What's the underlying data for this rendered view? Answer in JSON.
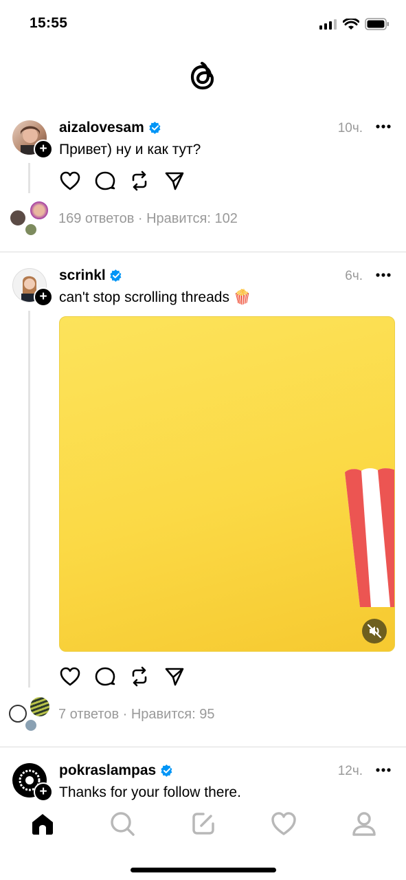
{
  "status": {
    "time": "15:55"
  },
  "icons": {
    "logo": "threads-logo-icon",
    "verified": "verified-badge-icon",
    "more": "more-dots-icon"
  },
  "colors": {
    "accent": "#0095f6",
    "muted": "#999999",
    "media_bg": "#fbd945"
  },
  "posts": [
    {
      "username": "aizalovesam",
      "time": "10ч.",
      "text": "Привет) ну и как тут?",
      "meta": "169 ответов · Нравится: 102"
    },
    {
      "username": "scrinkl",
      "time": "6ч.",
      "text": "can't stop scrolling threads 🍿",
      "meta": "7 ответов · Нравится: 95"
    },
    {
      "username": "pokraslampas",
      "time": "12ч.",
      "text": "Thanks for your follow there."
    }
  ],
  "nav": [
    "home-icon",
    "search-icon",
    "compose-icon",
    "heart-icon",
    "profile-icon"
  ]
}
